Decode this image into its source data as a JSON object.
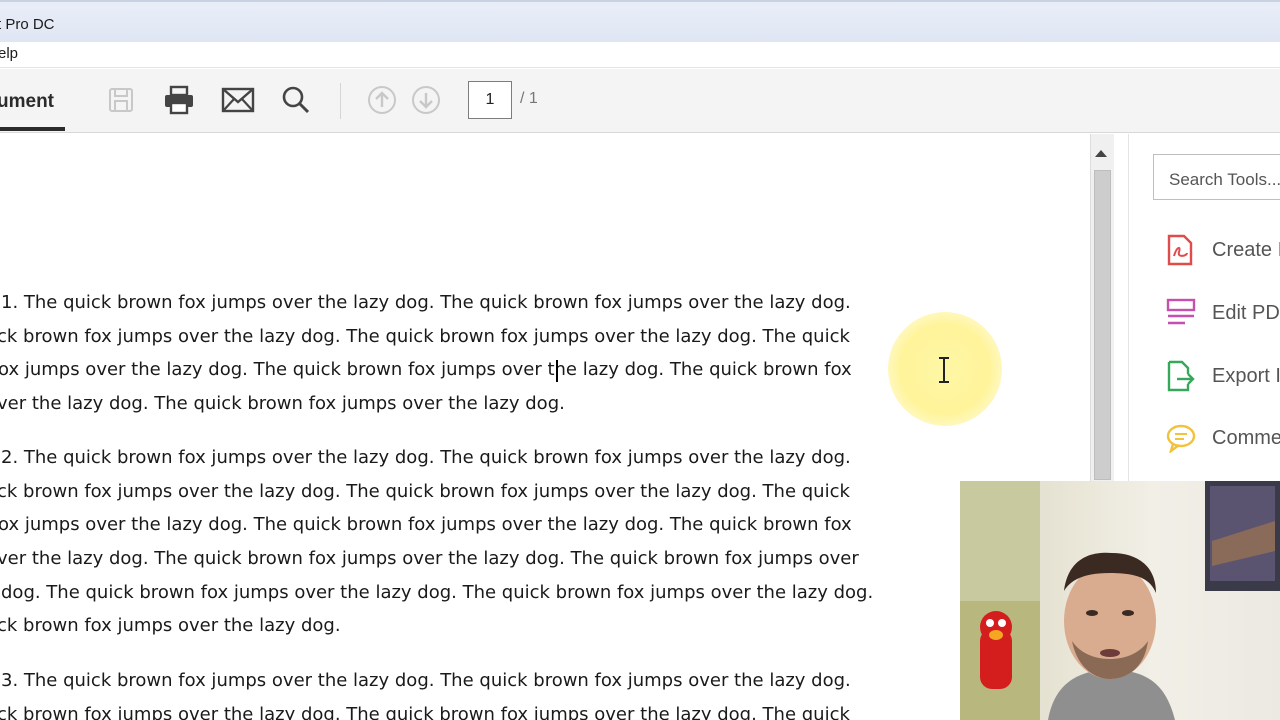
{
  "window": {
    "title": "t Pro DC"
  },
  "menu": {
    "help": "elp"
  },
  "toolbar": {
    "document_tab": "ument",
    "page_current": "1",
    "page_total": "/ 1",
    "icons": [
      "save-icon",
      "print-icon",
      "mail-icon",
      "search-icon",
      "page-up-icon",
      "page-down-icon"
    ]
  },
  "document": {
    "paragraphs": [
      {
        "lines": [
          "1. The quick brown fox jumps over the lazy dog. The quick brown fox jumps over the lazy dog.",
          "ck brown fox jumps over the lazy dog. The quick brown fox jumps over the lazy dog. The quick",
          "ox jumps over the lazy dog. The quick brown fox jumps over the lazy dog. The quick brown fox",
          "ver the lazy dog. The quick brown fox jumps over the lazy dog."
        ]
      },
      {
        "lines": [
          "2. The quick brown fox jumps over the lazy dog. The quick brown fox jumps over the lazy dog.",
          "ck brown fox jumps over the lazy dog. The quick brown fox jumps over the lazy dog. The quick",
          "ox jumps over the lazy dog. The quick brown fox jumps over the lazy dog. The quick brown fox",
          "ver the lazy dog. The quick brown fox jumps over the lazy dog. The quick brown fox jumps over",
          "dog. The quick brown fox jumps over the lazy dog. The quick brown fox jumps over the lazy dog.",
          "ck brown fox jumps over the lazy dog."
        ]
      },
      {
        "lines": [
          "3. The quick brown fox jumps over the lazy dog. The quick brown fox jumps over the lazy dog.",
          "ck brown fox jumps over the lazy dog. The quick brown fox jumps over the lazy dog. The quick"
        ]
      }
    ]
  },
  "right_panel": {
    "search_placeholder": "Search Tools...",
    "tools": [
      {
        "label": "Create I",
        "icon": "create-pdf-icon",
        "color": "#e04b4b"
      },
      {
        "label": "Edit PD",
        "icon": "edit-pdf-icon",
        "color": "#c64fb0"
      },
      {
        "label": "Export I",
        "icon": "export-pdf-icon",
        "color": "#36a85a"
      },
      {
        "label": "Comme",
        "icon": "comment-icon",
        "color": "#f2c23a"
      }
    ]
  },
  "colors": {
    "titlebar": "#e4eaf5",
    "toolbar": "#f4f4f4",
    "highlight": "#fff29a"
  }
}
